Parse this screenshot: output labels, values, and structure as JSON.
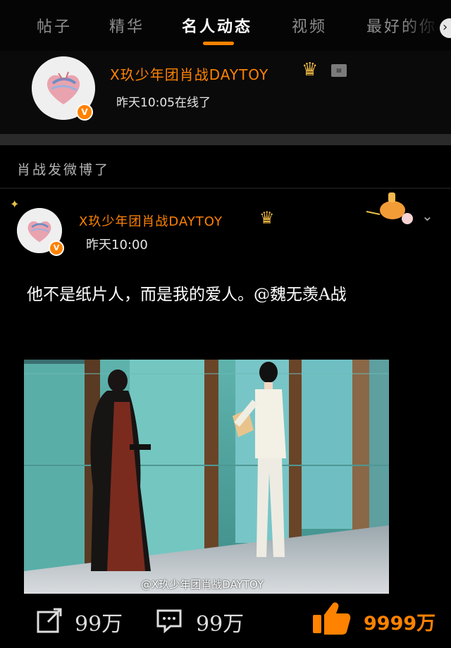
{
  "tabs": [
    {
      "label": "帖子",
      "active": false
    },
    {
      "label": "精华",
      "active": false
    },
    {
      "label": "名人动态",
      "active": true
    },
    {
      "label": "视频",
      "active": false
    },
    {
      "label": "最好的你",
      "active": false
    }
  ],
  "profile": {
    "name": "X玖少年团肖战DAYTOY",
    "status": "昨天10:05在线了",
    "verified_badge": "V",
    "icons": [
      "avatar-heart",
      "crown-icon",
      "vip-chip"
    ]
  },
  "section": {
    "label": "肖战发微博了"
  },
  "post": {
    "author": "X玖少年团肖战DAYTOY",
    "time": "昨天10:00",
    "text": "他不是纸片人，而是我的爱人。",
    "mention": "@魏无羡A战",
    "image_watermark": "@X玖少年团肖战DAYTOY",
    "badge_icon": "decoration-sticker-icon",
    "menu_icon": "chevron-down-icon"
  },
  "actions": {
    "repost_count": "99万",
    "comment_count": "99万",
    "like_count": "9999万"
  },
  "colors": {
    "accent": "#ff8200",
    "background": "#000000",
    "divider": "#2a2a2a"
  }
}
